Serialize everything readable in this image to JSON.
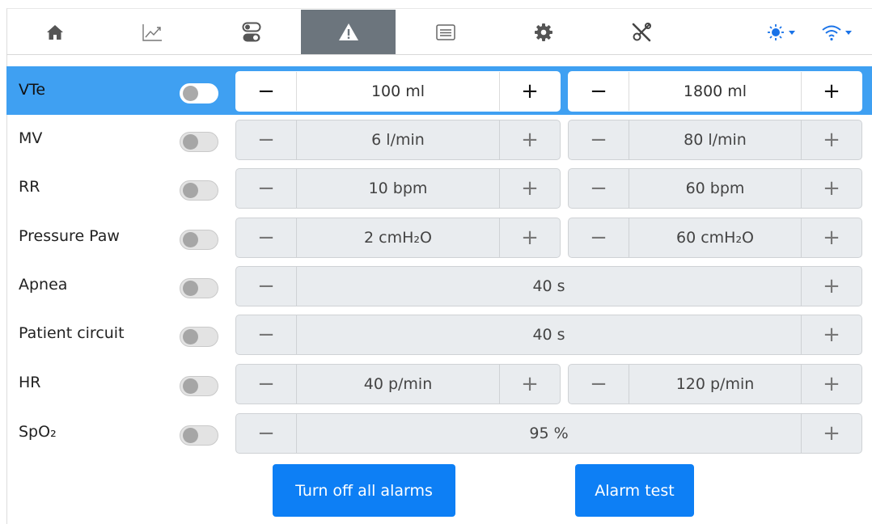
{
  "colors": {
    "accent": "#0d7ff5",
    "highlight_row": "#3fa0f2",
    "active_tab": "#6c757d",
    "status_icons": "#1a73e8"
  },
  "nav": {
    "tabs": [
      {
        "icon": "home-icon"
      },
      {
        "icon": "chart-icon"
      },
      {
        "icon": "toggles-icon"
      },
      {
        "icon": "warning-icon",
        "active": true
      },
      {
        "icon": "list-icon"
      },
      {
        "icon": "gear-icon"
      },
      {
        "icon": "tools-icon"
      }
    ],
    "status_icons": [
      "brightness-icon",
      "wifi-icon"
    ]
  },
  "alarms": [
    {
      "label": "VTe",
      "enabled": false,
      "selected": true,
      "low": "100 ml",
      "high": "1800 ml"
    },
    {
      "label": "MV",
      "enabled": false,
      "low": "6 l/min",
      "high": "80 l/min"
    },
    {
      "label": "RR",
      "enabled": false,
      "low": "10 bpm",
      "high": "60 bpm"
    },
    {
      "label": "Pressure Paw",
      "enabled": false,
      "low": "2 cmH₂O",
      "high": "60 cmH₂O"
    },
    {
      "label": "Apnea",
      "enabled": false,
      "value": "40 s"
    },
    {
      "label": "Patient circuit",
      "enabled": false,
      "value": "40 s"
    },
    {
      "label": "HR",
      "enabled": false,
      "low": "40 p/min",
      "high": "120 p/min"
    },
    {
      "label": "SpO₂",
      "enabled": false,
      "value": "95 %"
    }
  ],
  "stepper": {
    "minus": "−",
    "plus": "+"
  },
  "actions": {
    "turn_off_all": "Turn off all alarms",
    "alarm_test": "Alarm test"
  }
}
